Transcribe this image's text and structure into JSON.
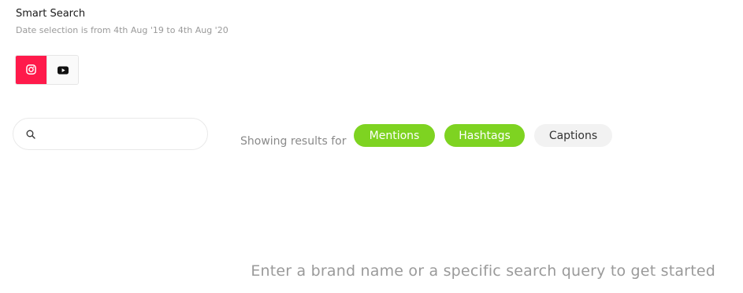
{
  "header": {
    "title": "Smart Search",
    "date_range_text": "Date selection is from 4th Aug '19 to 4th Aug '20"
  },
  "platforms": [
    {
      "name": "instagram",
      "icon": "instagram-icon",
      "active": true
    },
    {
      "name": "youtube",
      "icon": "youtube-icon",
      "active": false
    }
  ],
  "search": {
    "value": "",
    "placeholder": ""
  },
  "filters": {
    "label": "Showing results for",
    "chips": [
      {
        "label": "Mentions",
        "selected": true
      },
      {
        "label": "Hashtags",
        "selected": true
      },
      {
        "label": "Captions",
        "selected": false
      }
    ]
  },
  "empty_state": {
    "message": "Enter a brand name or a specific search query to get started"
  },
  "colors": {
    "accent_green": "#7ed321",
    "instagram_red": "#ff1a4b",
    "chip_off_bg": "#f2f2f2"
  }
}
